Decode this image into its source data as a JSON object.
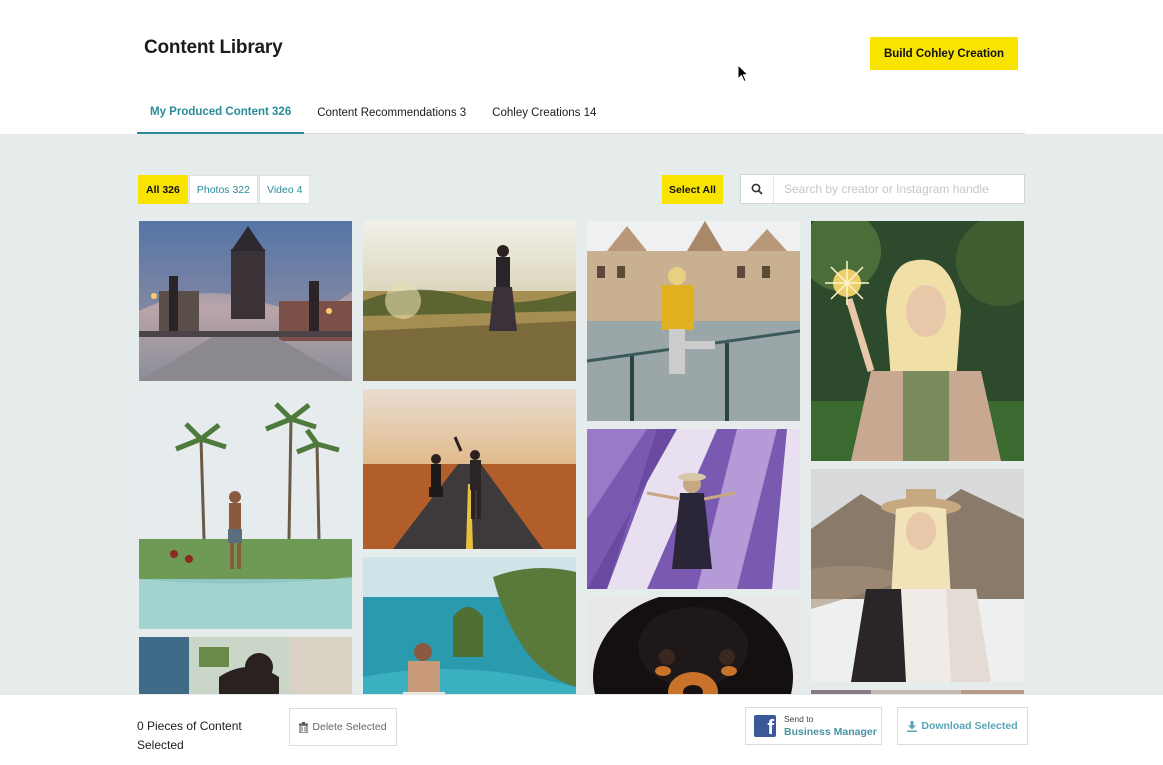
{
  "header": {
    "title": "Content Library",
    "build_button": "Build Cohley Creation"
  },
  "tabs": [
    {
      "label": "My Produced Content 326",
      "active": true
    },
    {
      "label": "Content Recommendations 3",
      "active": false
    },
    {
      "label": "Cohley Creations 14",
      "active": false
    }
  ],
  "filters": [
    {
      "label": "All 326",
      "active": true
    },
    {
      "label": "Photos 322",
      "active": false
    },
    {
      "label": "Video 4",
      "active": false
    }
  ],
  "select_all_label": "Select All",
  "search": {
    "placeholder": "Search by creator or Instagram handle",
    "value": ""
  },
  "gallery": [
    {
      "icon": "castle-bridge-photo"
    },
    {
      "icon": "woman-in-field-photo"
    },
    {
      "icon": "woman-on-railing-photo"
    },
    {
      "icon": "woman-sparkler-photo"
    },
    {
      "icon": "man-palm-trees-photo"
    },
    {
      "icon": "couple-on-road-photo"
    },
    {
      "icon": "lavender-field-photo"
    },
    {
      "icon": "woman-hat-mountains-photo"
    },
    {
      "icon": "coastal-cliffs-photo"
    },
    {
      "icon": "dog-closeup-photo"
    },
    {
      "icon": "partial-photo"
    },
    {
      "icon": "partial-photo"
    }
  ],
  "footer": {
    "count_text": "0 Pieces of Content Selected",
    "delete_label": "Delete Selected",
    "fb_small": "Send to",
    "fb_big": "Business Manager",
    "download_label": "Download Selected"
  },
  "colors": {
    "accent_yellow": "#f9e300",
    "accent_teal": "#2a8b99",
    "content_bg": "#e6eceb",
    "facebook_blue": "#3b5998"
  }
}
